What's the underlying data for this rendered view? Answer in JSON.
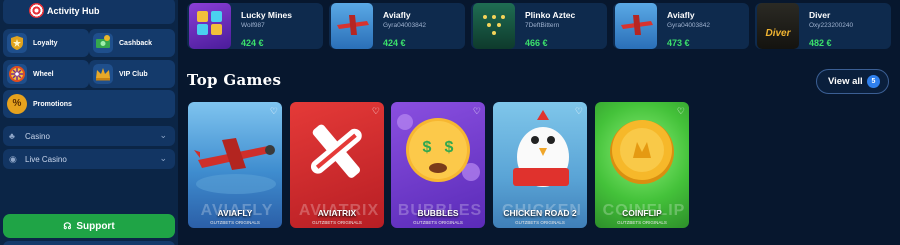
{
  "sidebar": {
    "activity_hub": "Activity Hub",
    "tiles": [
      {
        "label": "Loyalty",
        "icon": "shield-icon",
        "color": "#e2a31d"
      },
      {
        "label": "Cashback",
        "icon": "cash-icon",
        "color": "#35a74d"
      },
      {
        "label": "Wheel",
        "icon": "wheel-icon",
        "color": "#e14e1f"
      },
      {
        "label": "VIP Club",
        "icon": "crown-icon",
        "color": "#e8a928"
      }
    ],
    "promotions": "Promotions",
    "nav": [
      {
        "label": "Casino",
        "icon": "casino-icon"
      },
      {
        "label": "Live Casino",
        "icon": "live-icon"
      }
    ],
    "support": "Support"
  },
  "recent_wins": [
    {
      "game": "Lucky Mines",
      "user": "Wolf987",
      "amount": "424 €",
      "thumb_label": "LUCKY MINES"
    },
    {
      "game": "Aviafly",
      "user": "Gyra04003842",
      "amount": "424 €",
      "thumb_label": "AVIA FLY"
    },
    {
      "game": "Plinko Aztec",
      "user": "7DeftBittern",
      "amount": "466 €",
      "thumb_label": "PLINKO"
    },
    {
      "game": "Aviafly",
      "user": "Gyra04003842",
      "amount": "473 €",
      "thumb_label": "AVIA FLY"
    },
    {
      "game": "Diver",
      "user": "Oxy223200240",
      "amount": "482 €",
      "thumb_label": "Diver"
    }
  ],
  "top_games": {
    "title": "Top Games",
    "view_all": "View all",
    "count": "5",
    "cards": [
      {
        "name": "AVIAFLY",
        "ghost": "AVIAFLY",
        "sub": "GUTZBETS ORIGINALS"
      },
      {
        "name": "AVIATRIX",
        "ghost": "AVIATRIX",
        "sub": "GUTZBETS ORIGINALS"
      },
      {
        "name": "BUBBLES",
        "ghost": "BUBBLES",
        "sub": "GUTZBETS ORIGINALS"
      },
      {
        "name": "CHICKEN ROAD 2",
        "ghost": "CHICKEN",
        "sub": "GUTZBETS ORIGINALS"
      },
      {
        "name": "COINFLIP",
        "ghost": "COINFLIP",
        "sub": "GUTZBETS ORIGINALS"
      }
    ]
  }
}
